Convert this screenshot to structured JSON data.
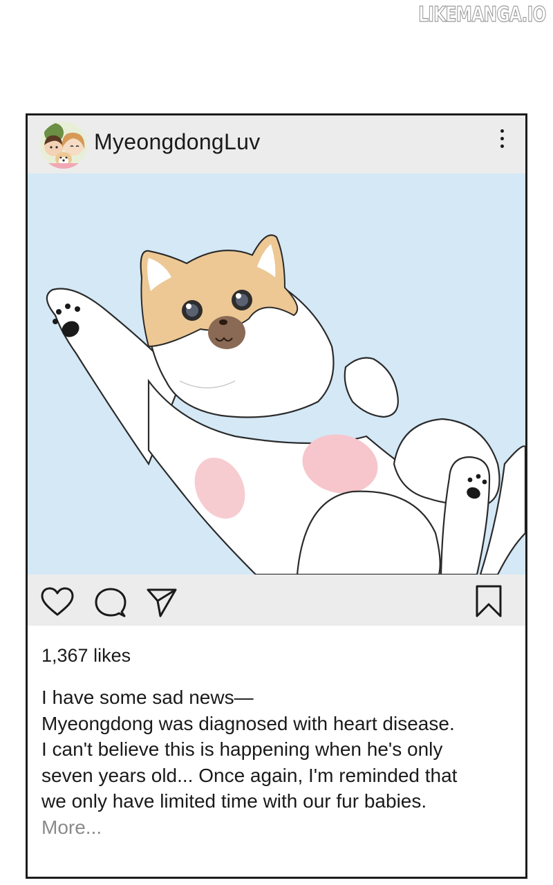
{
  "watermark": "LIKEMANGA.IO",
  "post": {
    "username": "MyeongdongLuv",
    "avatar_icon": "couple-with-dog-avatar",
    "menu_icon": "vertical-ellipsis-icon",
    "image_subject": "puppy-lying-on-back-illustration",
    "actions": {
      "like_icon": "heart-icon",
      "comment_icon": "speech-bubble-icon",
      "share_icon": "paper-plane-icon",
      "save_icon": "bookmark-icon"
    },
    "likes_text": "1,367 likes",
    "caption_lines": [
      "I have some sad news—",
      "Myeongdong was diagnosed with heart disease.",
      "I can't believe this is happening when he's only",
      "seven years old... Once again, I'm reminded that",
      "we only have limited time with our fur babies."
    ],
    "more_label": "More..."
  },
  "colors": {
    "header_bg": "#ececec",
    "image_bg": "#d4e8f6",
    "dog_fur": "#edc894",
    "paw_pad_pink": "#f6c6cc",
    "more_text": "#8a8a8a"
  }
}
